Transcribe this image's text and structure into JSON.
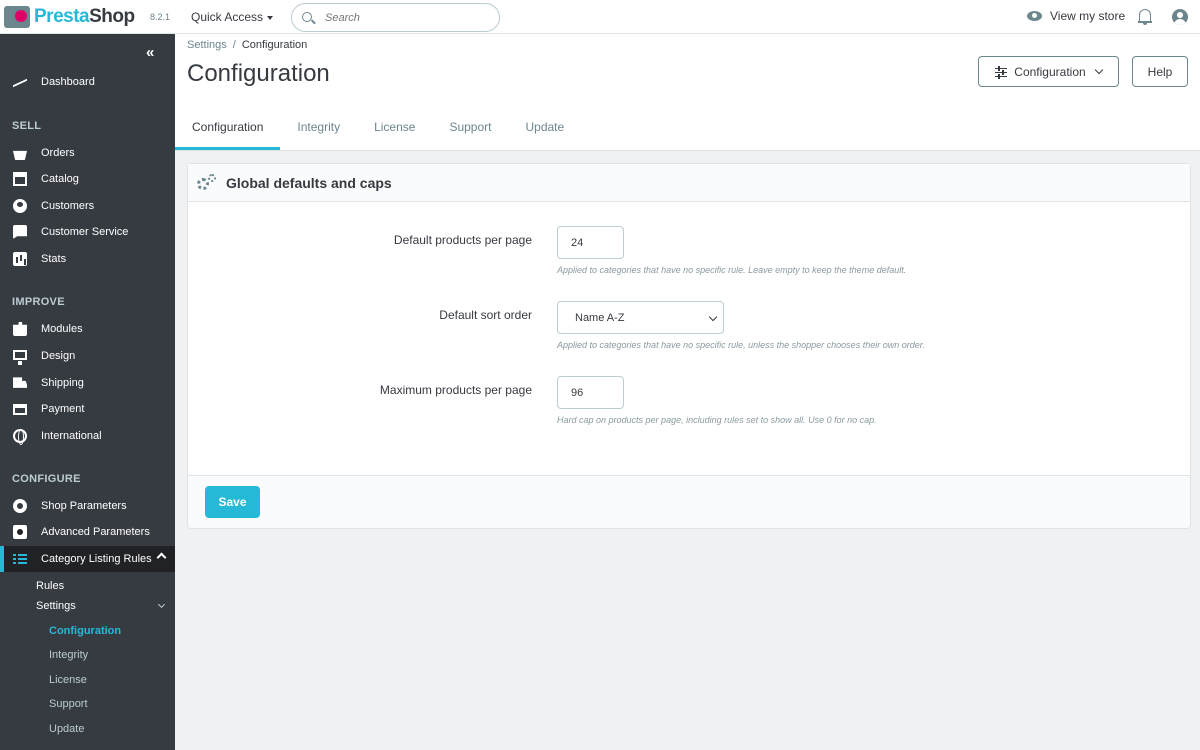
{
  "app": {
    "logo_text_a": "Presta",
    "logo_text_b": "Shop",
    "version": "8.2.1"
  },
  "topbar": {
    "quick_access": "Quick Access",
    "search_placeholder": "Search",
    "view_store": "View my store"
  },
  "sidebar": {
    "collapse_glyph": "«",
    "dashboard": "Dashboard",
    "sections": {
      "sell": "SELL",
      "improve": "IMPROVE",
      "configure": "CONFIGURE"
    },
    "sell_items": [
      "Orders",
      "Catalog",
      "Customers",
      "Customer Service",
      "Stats"
    ],
    "improve_items": [
      "Modules",
      "Design",
      "Shipping",
      "Payment",
      "International"
    ],
    "configure_items": [
      "Shop Parameters",
      "Advanced Parameters"
    ],
    "active_item": "Category Listing Rules",
    "sub_items": {
      "rules": "Rules",
      "settings": "Settings",
      "settings_children": [
        "Configuration",
        "Integrity",
        "License",
        "Support",
        "Update"
      ]
    }
  },
  "header": {
    "breadcrumb": {
      "parent": "Settings",
      "sep": "/",
      "current": "Configuration"
    },
    "title": "Configuration",
    "config_button": "Configuration",
    "help_button": "Help",
    "tabs": [
      "Configuration",
      "Integrity",
      "License",
      "Support",
      "Update"
    ],
    "active_tab": "Configuration"
  },
  "panel": {
    "title": "Global defaults and caps",
    "fields": {
      "per_page": {
        "label": "Default products per page",
        "value": "24",
        "help": "Applied to categories that have no specific rule. Leave empty to keep the theme default."
      },
      "sort": {
        "label": "Default sort order",
        "value": "Name A-Z",
        "help": "Applied to categories that have no specific rule, unless the shopper chooses their own order."
      },
      "max_per_page": {
        "label": "Maximum products per page",
        "value": "96",
        "help": "Hard cap on products per page, including rules set to show all. Use 0 for no cap."
      }
    },
    "save_button": "Save"
  },
  "colors": {
    "accent": "#25b9d7",
    "sidebar": "#363a41",
    "sidebar_active": "#202226",
    "text": "#363a41",
    "muted": "#6c868e"
  },
  "icons": [
    "logo-icon",
    "search-icon",
    "eye-icon",
    "bell-icon",
    "account-icon",
    "trend-icon",
    "basket-icon",
    "store-icon",
    "user-icon",
    "chat-icon",
    "stats-icon",
    "puzzle-icon",
    "monitor-icon",
    "truck-icon",
    "card-icon",
    "globe-icon",
    "gear-icon",
    "advanced-icon",
    "list-icon",
    "sliders-icon",
    "cogs-icon"
  ]
}
